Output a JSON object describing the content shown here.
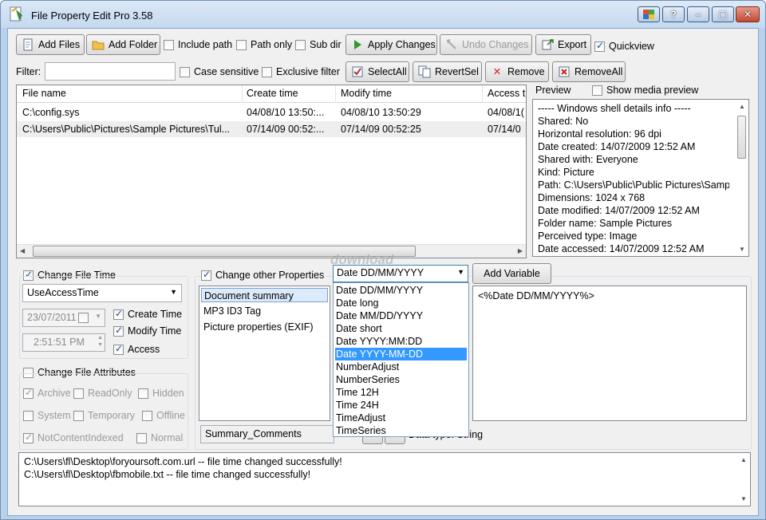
{
  "window": {
    "title": "File Property Edit Pro 3.58"
  },
  "toolbar": {
    "add_files": "Add Files",
    "add_folder": "Add Folder",
    "include_path": "Include path",
    "path_only": "Path only",
    "sub_dir": "Sub dir",
    "apply_changes": "Apply Changes",
    "undo_changes": "Undo Changes",
    "export": "Export",
    "quickview": "Quickview"
  },
  "filter": {
    "label": "Filter:",
    "value": "",
    "case_sensitive": "Case sensitive",
    "exclusive_filter": "Exclusive filter",
    "select_all": "SelectAll",
    "revert_sel": "RevertSel",
    "remove": "Remove",
    "remove_all": "RemoveAll"
  },
  "file_list": {
    "columns": [
      "File name",
      "Create time",
      "Modify time",
      "Access t"
    ],
    "rows": [
      [
        "C:\\config.sys",
        "04/08/10 13:50:...",
        "04/08/10 13:50:29",
        "04/08/1("
      ],
      [
        "C:\\Users\\Public\\Pictures\\Sample Pictures\\Tul...",
        "07/14/09 00:52:...",
        "07/14/09 00:52:25",
        "07/14/0"
      ]
    ]
  },
  "preview": {
    "label": "Preview",
    "show_media": "Show media preview",
    "lines": [
      "----- Windows shell details info -----",
      "Shared: No",
      "Horizontal resolution: 96 dpi",
      "Date created: 14/07/2009 12:52 AM",
      "Shared with: Everyone",
      "Kind: Picture",
      "Path: C:\\Users\\Public\\Public Pictures\\Samp",
      "Dimensions: 1024 x 768",
      "Date modified: 14/07/2009 12:52 AM",
      "Folder name: Sample Pictures",
      "Perceived type: Image",
      "Date accessed: 14/07/2009 12:52 AM"
    ]
  },
  "file_time": {
    "label": "Change File Time",
    "mode": "UseAccessTime",
    "date": "23/07/2011",
    "time": "2:51:51 PM",
    "create_time": "Create Time",
    "modify_time": "Modify Time",
    "access": "Access"
  },
  "attributes": {
    "label": "Change File Attributes",
    "archive": "Archive",
    "readonly": "ReadOnly",
    "hidden": "Hidden",
    "system": "System",
    "temporary": "Temporary",
    "offline": "Offline",
    "not_content_indexed": "NotContentIndexed",
    "normal": "Normal"
  },
  "other_props": {
    "label": "Change other Properties",
    "categories": [
      "Document summary",
      "MP3 ID3 Tag",
      "Picture properties (EXIF)"
    ],
    "selected_category": "Document summary",
    "field_name": "Summary_Comments",
    "data_type": "Data type: String",
    "variable_select": "Date DD/MM/YYYY",
    "add_variable": "Add Variable",
    "expression": "<%Date DD/MM/YYYY%>",
    "variable_options": [
      "Date DD/MM/YYYY",
      "Date long",
      "Date MM/DD/YYYY",
      "Date short",
      "Date YYYY:MM:DD",
      "Date YYYY-MM-DD",
      "NumberAdjust",
      "NumberSeries",
      "Time 12H",
      "Time 24H",
      "TimeAdjust",
      "TimeSeries"
    ],
    "highlighted_option": "Date YYYY-MM-DD"
  },
  "log": {
    "lines": [
      "C:\\Users\\fl\\Desktop\\foryoursoft.com.url -- file time changed successfully!",
      "C:\\Users\\fl\\Desktop\\fbmobile.txt -- file time changed successfully!"
    ]
  },
  "watermark": "download",
  "colors": {
    "titlebar": "#c4d9ef",
    "selection": "#3399ff",
    "close_button": "#c44a32"
  }
}
